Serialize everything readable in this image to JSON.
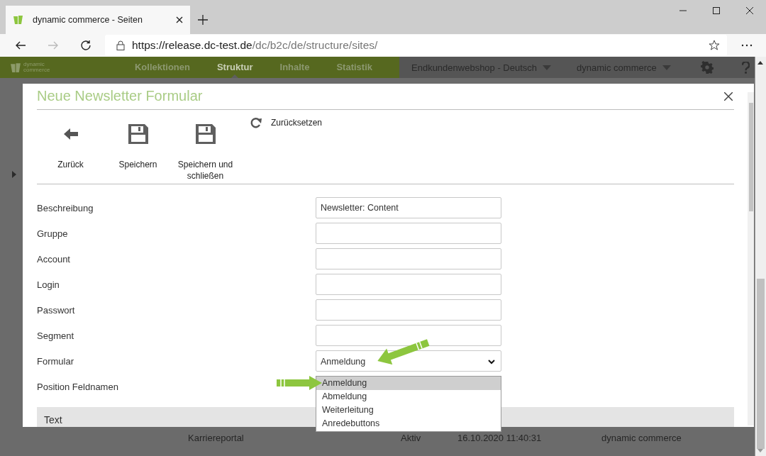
{
  "browser": {
    "tab_title": "dynamic commerce - Seiten",
    "url_host": "https://release.dc-test.de",
    "url_path": "/dc/b2c/de/structure/sites/"
  },
  "app_nav": {
    "logo_lines": [
      "dynamic",
      "commerce"
    ],
    "items": [
      {
        "label": "Kollektionen",
        "selected": false
      },
      {
        "label": "Struktur",
        "selected": true
      },
      {
        "label": "Inhalte",
        "selected": false
      },
      {
        "label": "Statistik",
        "selected": false
      }
    ],
    "shop": "Endkundenwebshop - Deutsch",
    "user": "dynamic commerce"
  },
  "background_row": [
    "Karriereportal",
    "Aktiv",
    "16.10.2020 11:40:31",
    "dynamic commerce"
  ],
  "modal": {
    "title": "Neue Newsletter Formular",
    "toolbar": [
      {
        "label": "Zurück",
        "kind": "back"
      },
      {
        "label": "Speichern",
        "kind": "save"
      },
      {
        "label": "Speichern und schließen",
        "kind": "save"
      }
    ],
    "reset": "Zurücksetzen",
    "fields": [
      {
        "label": "Beschreibung",
        "kind": "text",
        "value": "Newsletter: Content"
      },
      {
        "label": "Gruppe",
        "kind": "text"
      },
      {
        "label": "Account",
        "kind": "text"
      },
      {
        "label": "Login",
        "kind": "text"
      },
      {
        "label": "Passwort",
        "kind": "text"
      },
      {
        "label": "Segment",
        "kind": "text"
      },
      {
        "label": "Formular",
        "kind": "select",
        "value": "Anmeldung"
      },
      {
        "label": "Position Feldnamen",
        "kind": "covered"
      }
    ],
    "dropdown_options": [
      {
        "label": "Anmeldung",
        "selected": true
      },
      {
        "label": "Abmeldung",
        "selected": false
      },
      {
        "label": "Weiterleitung",
        "selected": false
      },
      {
        "label": "Anredebuttons",
        "selected": false
      }
    ],
    "section": "Text"
  }
}
